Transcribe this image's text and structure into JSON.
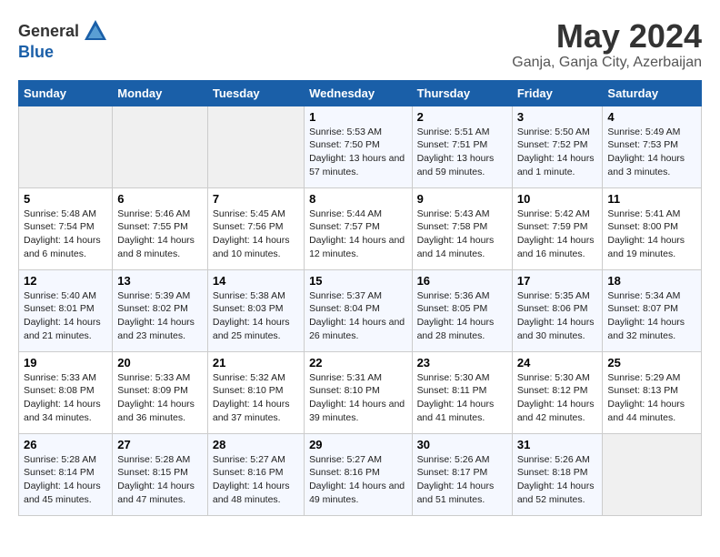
{
  "logo": {
    "general": "General",
    "blue": "Blue"
  },
  "title": "May 2024",
  "location": "Ganja, Ganja City, Azerbaijan",
  "days_of_week": [
    "Sunday",
    "Monday",
    "Tuesday",
    "Wednesday",
    "Thursday",
    "Friday",
    "Saturday"
  ],
  "weeks": [
    [
      {
        "day": "",
        "sunrise": "",
        "sunset": "",
        "daylight": "",
        "empty": true
      },
      {
        "day": "",
        "sunrise": "",
        "sunset": "",
        "daylight": "",
        "empty": true
      },
      {
        "day": "",
        "sunrise": "",
        "sunset": "",
        "daylight": "",
        "empty": true
      },
      {
        "day": "1",
        "sunrise": "Sunrise: 5:53 AM",
        "sunset": "Sunset: 7:50 PM",
        "daylight": "Daylight: 13 hours and 57 minutes."
      },
      {
        "day": "2",
        "sunrise": "Sunrise: 5:51 AM",
        "sunset": "Sunset: 7:51 PM",
        "daylight": "Daylight: 13 hours and 59 minutes."
      },
      {
        "day": "3",
        "sunrise": "Sunrise: 5:50 AM",
        "sunset": "Sunset: 7:52 PM",
        "daylight": "Daylight: 14 hours and 1 minute."
      },
      {
        "day": "4",
        "sunrise": "Sunrise: 5:49 AM",
        "sunset": "Sunset: 7:53 PM",
        "daylight": "Daylight: 14 hours and 3 minutes."
      }
    ],
    [
      {
        "day": "5",
        "sunrise": "Sunrise: 5:48 AM",
        "sunset": "Sunset: 7:54 PM",
        "daylight": "Daylight: 14 hours and 6 minutes."
      },
      {
        "day": "6",
        "sunrise": "Sunrise: 5:46 AM",
        "sunset": "Sunset: 7:55 PM",
        "daylight": "Daylight: 14 hours and 8 minutes."
      },
      {
        "day": "7",
        "sunrise": "Sunrise: 5:45 AM",
        "sunset": "Sunset: 7:56 PM",
        "daylight": "Daylight: 14 hours and 10 minutes."
      },
      {
        "day": "8",
        "sunrise": "Sunrise: 5:44 AM",
        "sunset": "Sunset: 7:57 PM",
        "daylight": "Daylight: 14 hours and 12 minutes."
      },
      {
        "day": "9",
        "sunrise": "Sunrise: 5:43 AM",
        "sunset": "Sunset: 7:58 PM",
        "daylight": "Daylight: 14 hours and 14 minutes."
      },
      {
        "day": "10",
        "sunrise": "Sunrise: 5:42 AM",
        "sunset": "Sunset: 7:59 PM",
        "daylight": "Daylight: 14 hours and 16 minutes."
      },
      {
        "day": "11",
        "sunrise": "Sunrise: 5:41 AM",
        "sunset": "Sunset: 8:00 PM",
        "daylight": "Daylight: 14 hours and 19 minutes."
      }
    ],
    [
      {
        "day": "12",
        "sunrise": "Sunrise: 5:40 AM",
        "sunset": "Sunset: 8:01 PM",
        "daylight": "Daylight: 14 hours and 21 minutes."
      },
      {
        "day": "13",
        "sunrise": "Sunrise: 5:39 AM",
        "sunset": "Sunset: 8:02 PM",
        "daylight": "Daylight: 14 hours and 23 minutes."
      },
      {
        "day": "14",
        "sunrise": "Sunrise: 5:38 AM",
        "sunset": "Sunset: 8:03 PM",
        "daylight": "Daylight: 14 hours and 25 minutes."
      },
      {
        "day": "15",
        "sunrise": "Sunrise: 5:37 AM",
        "sunset": "Sunset: 8:04 PM",
        "daylight": "Daylight: 14 hours and 26 minutes."
      },
      {
        "day": "16",
        "sunrise": "Sunrise: 5:36 AM",
        "sunset": "Sunset: 8:05 PM",
        "daylight": "Daylight: 14 hours and 28 minutes."
      },
      {
        "day": "17",
        "sunrise": "Sunrise: 5:35 AM",
        "sunset": "Sunset: 8:06 PM",
        "daylight": "Daylight: 14 hours and 30 minutes."
      },
      {
        "day": "18",
        "sunrise": "Sunrise: 5:34 AM",
        "sunset": "Sunset: 8:07 PM",
        "daylight": "Daylight: 14 hours and 32 minutes."
      }
    ],
    [
      {
        "day": "19",
        "sunrise": "Sunrise: 5:33 AM",
        "sunset": "Sunset: 8:08 PM",
        "daylight": "Daylight: 14 hours and 34 minutes."
      },
      {
        "day": "20",
        "sunrise": "Sunrise: 5:33 AM",
        "sunset": "Sunset: 8:09 PM",
        "daylight": "Daylight: 14 hours and 36 minutes."
      },
      {
        "day": "21",
        "sunrise": "Sunrise: 5:32 AM",
        "sunset": "Sunset: 8:10 PM",
        "daylight": "Daylight: 14 hours and 37 minutes."
      },
      {
        "day": "22",
        "sunrise": "Sunrise: 5:31 AM",
        "sunset": "Sunset: 8:10 PM",
        "daylight": "Daylight: 14 hours and 39 minutes."
      },
      {
        "day": "23",
        "sunrise": "Sunrise: 5:30 AM",
        "sunset": "Sunset: 8:11 PM",
        "daylight": "Daylight: 14 hours and 41 minutes."
      },
      {
        "day": "24",
        "sunrise": "Sunrise: 5:30 AM",
        "sunset": "Sunset: 8:12 PM",
        "daylight": "Daylight: 14 hours and 42 minutes."
      },
      {
        "day": "25",
        "sunrise": "Sunrise: 5:29 AM",
        "sunset": "Sunset: 8:13 PM",
        "daylight": "Daylight: 14 hours and 44 minutes."
      }
    ],
    [
      {
        "day": "26",
        "sunrise": "Sunrise: 5:28 AM",
        "sunset": "Sunset: 8:14 PM",
        "daylight": "Daylight: 14 hours and 45 minutes."
      },
      {
        "day": "27",
        "sunrise": "Sunrise: 5:28 AM",
        "sunset": "Sunset: 8:15 PM",
        "daylight": "Daylight: 14 hours and 47 minutes."
      },
      {
        "day": "28",
        "sunrise": "Sunrise: 5:27 AM",
        "sunset": "Sunset: 8:16 PM",
        "daylight": "Daylight: 14 hours and 48 minutes."
      },
      {
        "day": "29",
        "sunrise": "Sunrise: 5:27 AM",
        "sunset": "Sunset: 8:16 PM",
        "daylight": "Daylight: 14 hours and 49 minutes."
      },
      {
        "day": "30",
        "sunrise": "Sunrise: 5:26 AM",
        "sunset": "Sunset: 8:17 PM",
        "daylight": "Daylight: 14 hours and 51 minutes."
      },
      {
        "day": "31",
        "sunrise": "Sunrise: 5:26 AM",
        "sunset": "Sunset: 8:18 PM",
        "daylight": "Daylight: 14 hours and 52 minutes."
      },
      {
        "day": "",
        "sunrise": "",
        "sunset": "",
        "daylight": "",
        "empty": true
      }
    ]
  ]
}
